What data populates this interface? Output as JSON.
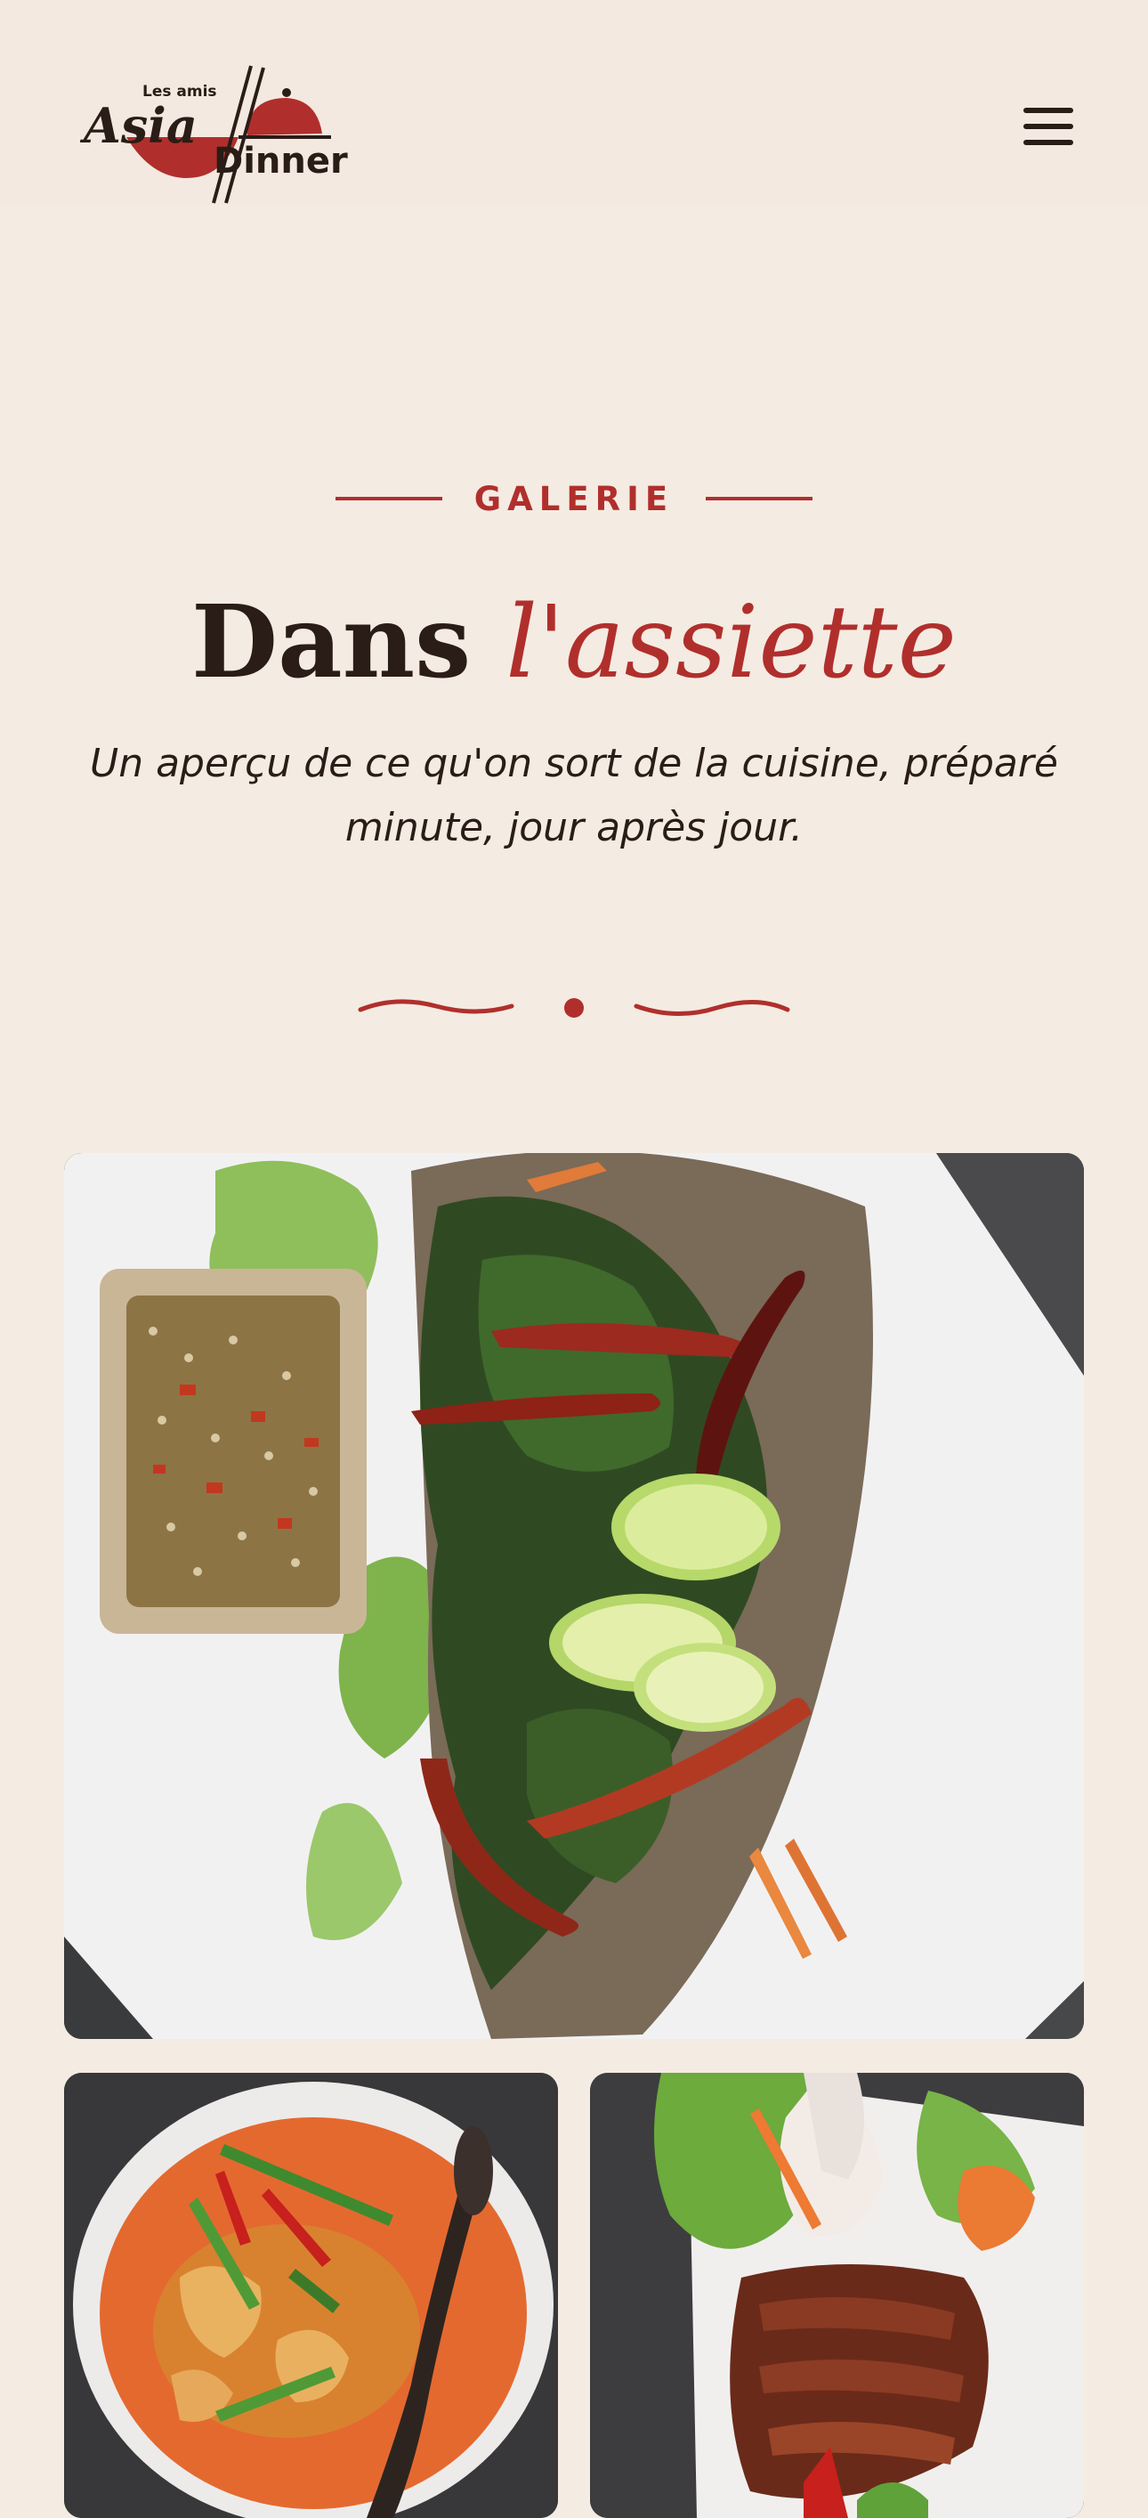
{
  "header": {
    "logo": {
      "small_text": "Les amis",
      "word_one": "Asia",
      "word_two": "Dinner",
      "icon": "cloche-chopsticks-logo"
    },
    "menu_icon": "hamburger-menu-icon"
  },
  "hero": {
    "eyebrow": "GALERIE",
    "title_plain": "Dans",
    "title_accent": "l'assiette",
    "subtitle": "Un aperçu de ce qu'on sort de la cuisine, préparé minute, jour après jour.",
    "ornament_icon": "wave-dot-divider-icon"
  },
  "gallery": {
    "photos": [
      {
        "subject": "fried fish with chili, lime and herbs"
      },
      {
        "subject": "red curry soup with chili and herbs"
      },
      {
        "subject": "roasted duck with salad and carved garnish"
      }
    ]
  },
  "colors": {
    "background": "#f4ebe2",
    "accent": "#b02f2c",
    "text": "#2a1c16"
  }
}
